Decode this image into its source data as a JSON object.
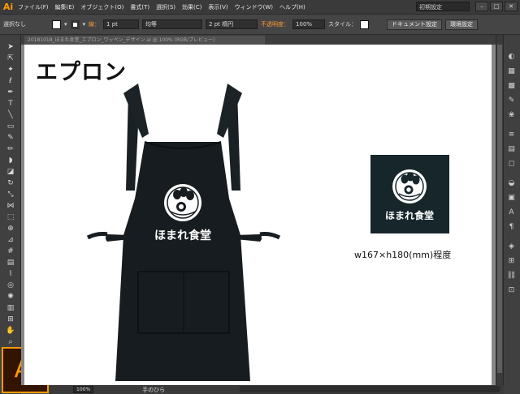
{
  "app": {
    "logo_small": "Ai",
    "logo_large": "Ai"
  },
  "menubar": {
    "items": [
      "ファイル(F)",
      "編集(E)",
      "オブジェクト(O)",
      "書式(T)",
      "選択(S)",
      "効果(C)",
      "表示(V)",
      "ウィンドウ(W)",
      "ヘルプ(H)"
    ],
    "workspace_preset": "初期設定"
  },
  "controlbar": {
    "selection_status": "選択なし",
    "stroke_label": "線：",
    "stroke_weight": "1 pt",
    "profile": "均等",
    "brush": "2 pt 楕円",
    "opacity_label": "不透明度：",
    "opacity_value": "100%",
    "style_label": "スタイル：",
    "doc_settings_button": "ドキュメント設定",
    "env_settings_button": "環境設定"
  },
  "document": {
    "tab_title": "20181018_ほまれ食堂_エプロン_ワッペン_デザイン.ai @ 100% (RGB/プレビュー)"
  },
  "artboard": {
    "heading": "エプロン",
    "apron_logo_text": "ほまれ食堂",
    "patch_logo_text": "ほまれ食堂",
    "size_label": "w167×h180(mm)程度"
  },
  "statusbar": {
    "zoom": "100%",
    "tool_name": "手のひら"
  },
  "colors": {
    "apron": "#161c1f",
    "patch": "#17262b",
    "ai_orange": "#ff9a00"
  }
}
